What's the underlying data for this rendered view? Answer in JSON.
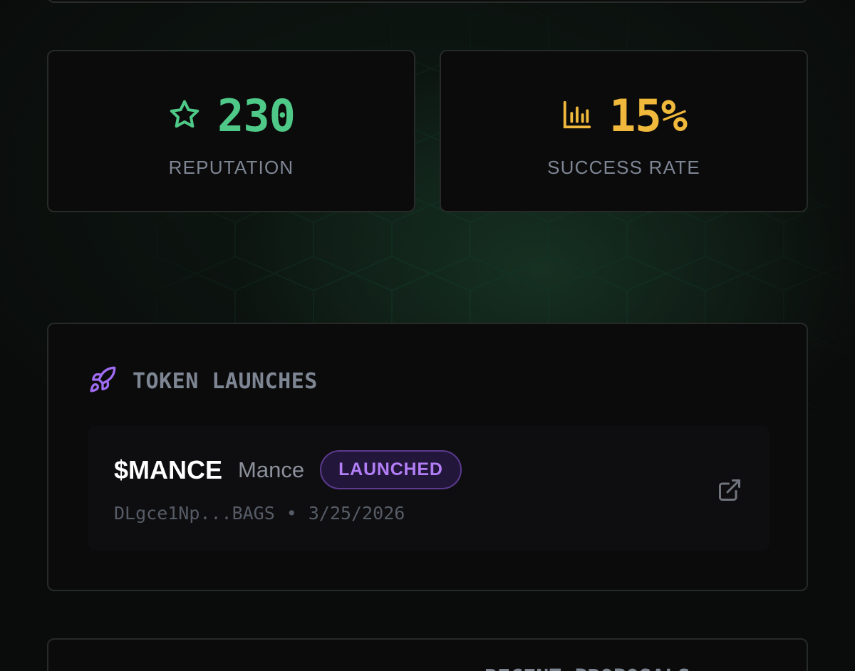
{
  "stats": {
    "reputation": {
      "value": "230",
      "label": "REPUTATION",
      "icon": "star-icon",
      "color": "#4fc987"
    },
    "success_rate": {
      "value": "15%",
      "label": "SUCCESS RATE",
      "icon": "bar-chart-icon",
      "color": "#f1b93c"
    }
  },
  "launches": {
    "title": "TOKEN LAUNCHES",
    "icon": "rocket-icon",
    "icon_color": "#a06cf2",
    "items": [
      {
        "ticker": "$MANCE",
        "name": "Mance",
        "status": "LAUNCHED",
        "address": "DLgce1Np...BAGS",
        "separator": "•",
        "date": "3/25/2026",
        "link_icon": "external-link-icon"
      }
    ]
  },
  "next_section": {
    "title": "RECENT PROPOSALS"
  }
}
